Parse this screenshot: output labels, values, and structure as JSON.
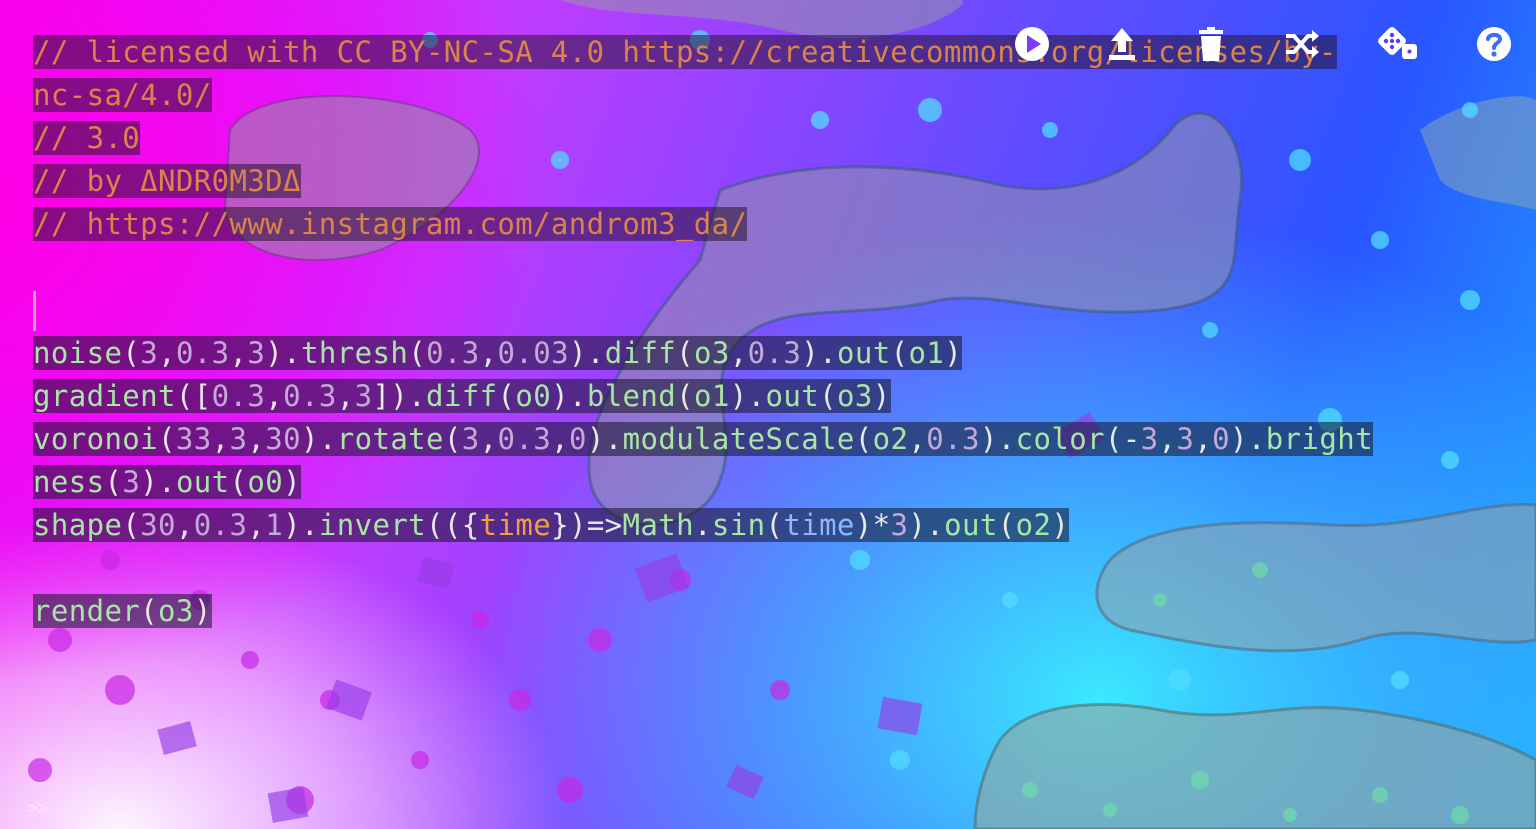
{
  "editor": {
    "comment_lines": [
      "// licensed with CC BY-NC-SA 4.0 https://creativecommons.org/licenses/by-",
      "nc-sa/4.0/",
      "// 3.0",
      "// by ΔNDR0M3DΔ",
      "// https://www.instagram.com/androm3_da/"
    ],
    "code": {
      "line1": {
        "t1": "noise",
        "t2": "(",
        "t3": "3",
        "t4": ",",
        "t5": "0.3",
        "t6": ",",
        "t7": "3",
        "t8": ").",
        "t9": "thresh",
        "t10": "(",
        "t11": "0.3",
        "t12": ",",
        "t13": "0.03",
        "t14": ").",
        "t15": "diff",
        "t16": "(",
        "t17": "o3",
        "t18": ",",
        "t19": "0.3",
        "t20": ").",
        "t21": "out",
        "t22": "(",
        "t23": "o1",
        "t24": ")"
      },
      "line2": {
        "t1": "gradient",
        "t2": "([",
        "t3": "0.3",
        "t4": ",",
        "t5": "0.3",
        "t6": ",",
        "t7": "3",
        "t8": "]).",
        "t9": "diff",
        "t10": "(",
        "t11": "o0",
        "t12": ").",
        "t13": "blend",
        "t14": "(",
        "t15": "o1",
        "t16": ").",
        "t17": "out",
        "t18": "(",
        "t19": "o3",
        "t20": ")"
      },
      "line3a": {
        "t1": "voronoi",
        "t2": "(",
        "t3": "33",
        "t4": ",",
        "t5": "3",
        "t6": ",",
        "t7": "30",
        "t8": ").",
        "t9": "rotate",
        "t10": "(",
        "t11": "3",
        "t12": ",",
        "t13": "0.3",
        "t14": ",",
        "t15": "0",
        "t16": ").",
        "t17": "modulateScale",
        "t18": "(",
        "t19": "o2",
        "t20": ",",
        "t21": "0.3",
        "t22": ").",
        "t23": "color",
        "t24": "(-",
        "t25": "3",
        "t26": ",",
        "t27": "3",
        "t28": ",",
        "t29": "0",
        "t30": ").",
        "t31": "bright"
      },
      "line3b": {
        "t1": "ness",
        "t2": "(",
        "t3": "3",
        "t4": ").",
        "t5": "out",
        "t6": "(",
        "t7": "o0",
        "t8": ")"
      },
      "line4": {
        "t1": "shape",
        "t2": "(",
        "t3": "30",
        "t4": ",",
        "t5": "0.3",
        "t6": ",",
        "t7": "1",
        "t8": ").",
        "t9": "invert",
        "t10": "(({",
        "t11": "time",
        "t12": "})=>",
        "t13": "Math",
        "t14": ".",
        "t15": "sin",
        "t16": "(",
        "t17": "time",
        "t18": ")*",
        "t19": "3",
        "t20": ").",
        "t21": "out",
        "t22": "(",
        "t23": "o2",
        "t24": ")"
      },
      "line5": {
        "t1": "render",
        "t2": "(",
        "t3": "o3",
        "t4": ")"
      }
    },
    "prompt_symbol": ">>"
  },
  "toolbar": {
    "icons": [
      "play-icon",
      "upload-icon",
      "trash-icon",
      "shuffle-icon",
      "dice-icon",
      "help-icon"
    ]
  },
  "colors": {
    "comment": "#d9844a",
    "function": "#a9e6a6",
    "number": "#c3a8d8",
    "param_orange": "#f0a040",
    "param_blue": "#8fb6ff",
    "line_highlight": "rgba(20,20,40,0.55)"
  }
}
